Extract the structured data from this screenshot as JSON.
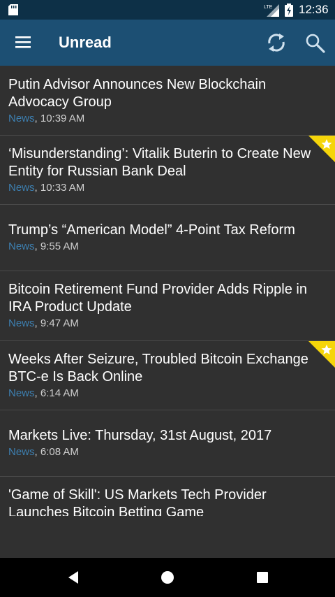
{
  "status_bar": {
    "time": "12:36",
    "network": "LTE",
    "icons": [
      "sd-card-icon",
      "signal-icon",
      "battery-icon"
    ]
  },
  "app_bar": {
    "title": "Unread",
    "icons": [
      "menu-icon",
      "refresh-icon",
      "search-icon"
    ],
    "color": "#1c4f73"
  },
  "articles": [
    {
      "headline": "Putin Advisor Announces New Blockchain Advocacy Group",
      "category": "News",
      "time": ", 10:39 AM",
      "starred": false
    },
    {
      "headline": "‘Misunderstanding’: Vitalik Buterin to Create New Entity for Russian Bank Deal",
      "category": "News",
      "time": ", 10:33 AM",
      "starred": true
    },
    {
      "headline": "Trump’s “American Model” 4-Point Tax Reform",
      "category": "News",
      "time": ", 9:55 AM",
      "starred": false
    },
    {
      "headline": "Bitcoin Retirement Fund Provider Adds Ripple in IRA Product Update",
      "category": "News",
      "time": ", 9:47 AM",
      "starred": false
    },
    {
      "headline": "Weeks After Seizure, Troubled Bitcoin Exchange BTC-e Is Back Online",
      "category": "News",
      "time": ", 6:14 AM",
      "starred": true
    },
    {
      "headline": "Markets Live: Thursday, 31st August, 2017",
      "category": "News",
      "time": ", 6:08 AM",
      "starred": false
    },
    {
      "headline": "'Game of Skill': US Markets Tech Provider Launches Bitcoin Betting Game",
      "category": "",
      "time": "",
      "starred": false
    }
  ],
  "colors": {
    "category": "#3d7fb0",
    "star_badge": "#f5d50a",
    "background": "#303030"
  },
  "nav_bar": {
    "icons": [
      "back-icon",
      "home-icon",
      "recents-icon"
    ]
  }
}
